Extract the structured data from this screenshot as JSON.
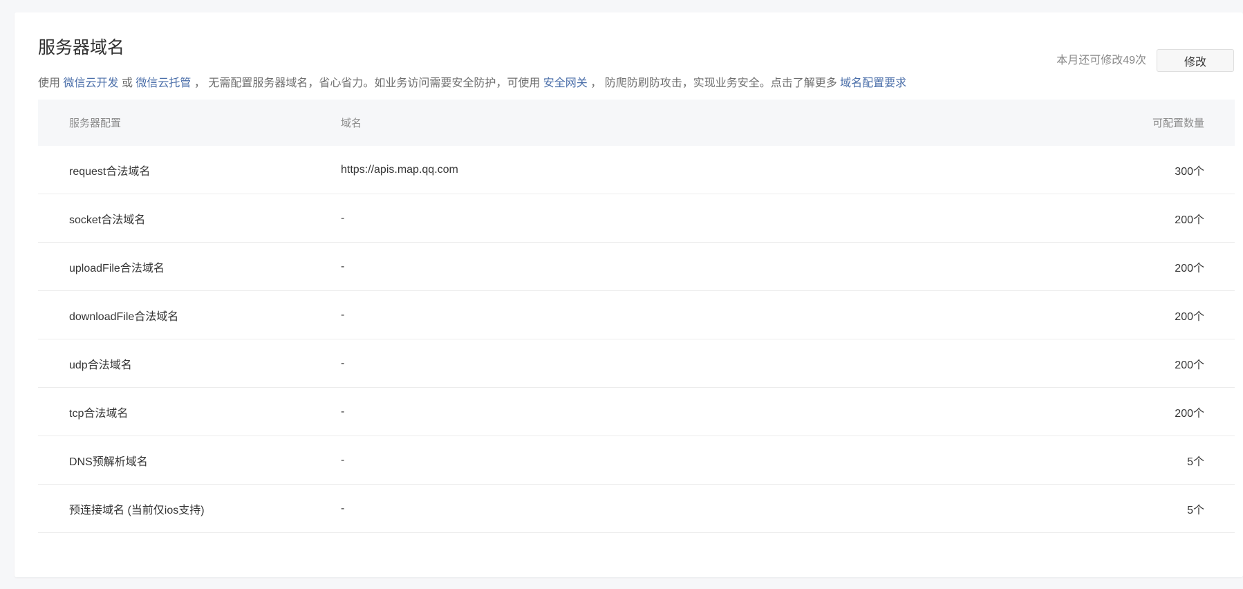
{
  "section": {
    "title": "服务器域名",
    "desc_prefix": "使用",
    "link_cloud_dev": "微信云开发",
    "or_text": "或",
    "link_cloud_hosting": "微信云托管",
    "desc_middle": "，  无需配置服务器域名，省心省力。如业务访问需要安全防护，可使用",
    "link_gateway": "安全网关",
    "desc_middle2": "，  防爬防刷防攻击，实现业务安全。点击了解更多",
    "link_requirements": "域名配置要求"
  },
  "header_actions": {
    "quota_text": "本月还可修改49次",
    "modify_label": "修改"
  },
  "table": {
    "columns": {
      "config": "服务器配置",
      "domain": "域名",
      "count": "可配置数量"
    },
    "rows": [
      {
        "config": "request合法域名",
        "domain": "https://apis.map.qq.com",
        "count": "300个"
      },
      {
        "config": "socket合法域名",
        "domain": "-",
        "count": "200个"
      },
      {
        "config": "uploadFile合法域名",
        "domain": "-",
        "count": "200个"
      },
      {
        "config": "downloadFile合法域名",
        "domain": "-",
        "count": "200个"
      },
      {
        "config": "udp合法域名",
        "domain": "-",
        "count": "200个"
      },
      {
        "config": "tcp合法域名",
        "domain": "-",
        "count": "200个"
      },
      {
        "config": "DNS预解析域名",
        "domain": "-",
        "count": "5个"
      },
      {
        "config": "预连接域名 (当前仅ios支持)",
        "domain": "-",
        "count": "5个"
      }
    ]
  },
  "colors": {
    "link": "#4a6ea9",
    "page_bg": "#f6f7f9",
    "header_bg": "#f6f7f9"
  }
}
